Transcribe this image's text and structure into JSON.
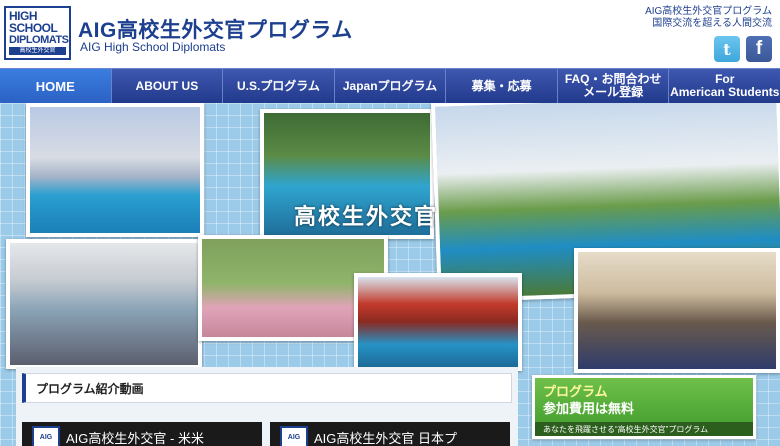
{
  "header": {
    "logo": {
      "line1": "HIGH",
      "line2": "SCHOOL",
      "line3": "DIPLOMATS",
      "sub": "高校生外交官"
    },
    "title": "AIG高校生外交官プログラム",
    "subtitle": "AIG High School Diplomats",
    "tagline_line1": "AIG高校生外交官プログラム",
    "tagline_line2": "国際交流を超える人間交流",
    "social": {
      "twitter": "t",
      "facebook": "f"
    }
  },
  "nav": {
    "items": [
      {
        "label": "HOME",
        "active": true
      },
      {
        "label": "ABOUT US"
      },
      {
        "label": "U.S.プログラム"
      },
      {
        "label": "Japanプログラム"
      },
      {
        "label": "募集・応募"
      },
      {
        "label_line1": "FAQ・お問合わせ",
        "label_line2": "メール登録"
      },
      {
        "label_line1": "For",
        "label_line2": "American Students"
      }
    ]
  },
  "hero": {
    "caption": "高校生外交官"
  },
  "content": {
    "section_title": "プログラム紹介動画",
    "videos": [
      {
        "logo": "AIG",
        "title": "AIG高校生外交官 - 米米"
      },
      {
        "logo": "AIG",
        "title": "AIG高校生外交官 日本プ"
      }
    ]
  },
  "banner": {
    "line1": "プログラム",
    "line2": "参加費用は無料",
    "line3": "あなたを飛躍させる“高校生外交官”プログラム"
  },
  "colors": {
    "brand": "#1d3f8f",
    "nav": "#2b4aa0",
    "nav_active": "#3b7de0",
    "banner": "#4caf35"
  }
}
